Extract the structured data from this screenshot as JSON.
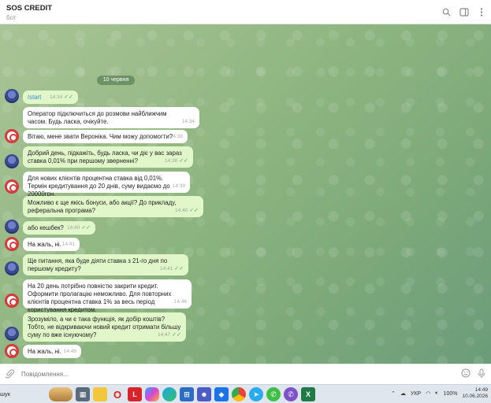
{
  "header": {
    "title": "SOS CREDIT",
    "subtitle": "бот",
    "icons": [
      "search-icon",
      "side-panel-icon",
      "more-vert-icon"
    ]
  },
  "chat": {
    "date_chip": "10 червня",
    "messages": [
      {
        "from": "user",
        "text": "/start",
        "time": "14:34"
      },
      {
        "from": "bot",
        "text": "Оператор підключиться до розмови найближчим часом. Будь ласка, очікуйте.",
        "time": "14:34"
      },
      {
        "from": "bot",
        "text": "Вітаю, мене звати Вероніка. Чим можу допомогти?",
        "time": "14:38"
      },
      {
        "from": "user",
        "text": "Добрий день, підкажіть, будь ласка, чи діє у вас зараз ставка 0,01% при першому зверненні?",
        "time": "14:38"
      },
      {
        "from": "bot",
        "text": "Для нових клієнтів процентна ставка від 0,01%. Термін кредитування до 20 днів, суму видаємо до 20000грн.",
        "time": "14:39"
      },
      {
        "from": "user",
        "text": "Можливо є ще якісь бонуси, або акції? До прикладу, реферальна програма?",
        "time": "14:40"
      },
      {
        "from": "user",
        "text": "або кешбек?",
        "time": "14:40"
      },
      {
        "from": "bot",
        "text": "На жаль, ні.",
        "time": "14:41"
      },
      {
        "from": "user",
        "text": "Ще питання, яка буде діяти ставка з 21-го дня по першому кредиту?",
        "time": "14:41"
      },
      {
        "from": "bot",
        "text": "На 20 день потрібно повністю закрити кредит. Оформити пролагацію неможливо. Для повторних клієнтів процентна ставка 1% за весь період користування кредитом.",
        "time": "14:46"
      },
      {
        "from": "user",
        "text": "Зрозуміло, а чи є така функція, як добір коштів? Тобто, не відкриваючи новий кредит отримати більшу суму по вже існуючому?",
        "time": "14:47"
      },
      {
        "from": "bot",
        "text": "На жаль, ні.",
        "time": "14:49"
      }
    ]
  },
  "composer": {
    "placeholder": "Повідомлення...",
    "icons": [
      "paperclip-icon",
      "emoji-icon",
      "microphone-icon"
    ]
  },
  "taskbar": {
    "search_label": "шук",
    "apps": [
      "burger-widget",
      "file-explorer",
      "folder",
      "opera",
      "l-app",
      "copilot",
      "edge",
      "teams-grid",
      "people",
      "dropbox",
      "chrome",
      "telegram",
      "whatsapp",
      "viber",
      "excel"
    ],
    "tray": {
      "lang": "УКР",
      "battery": "100%",
      "time": "14:49",
      "date": "10.06.2026"
    }
  },
  "colors": {
    "outgoing_bubble": "#e1f7c9",
    "incoming_bubble": "#ffffff",
    "tick_green": "#56a65c",
    "command_link": "#3a8fd0"
  }
}
